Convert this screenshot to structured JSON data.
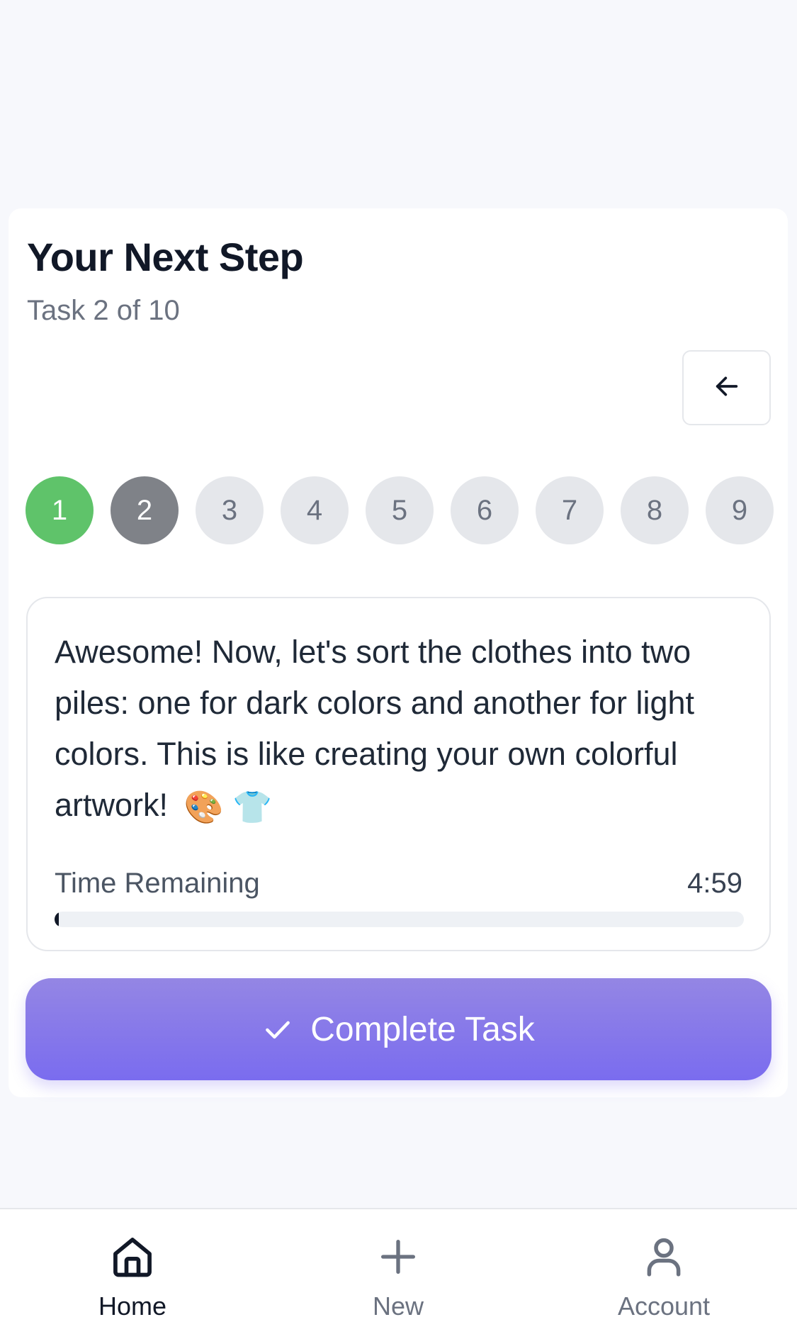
{
  "card": {
    "title": "Your Next Step",
    "subtitle": "Task 2 of 10"
  },
  "back_button": {
    "icon": "arrow-left-icon"
  },
  "steps": [
    {
      "label": "1",
      "state": "done"
    },
    {
      "label": "2",
      "state": "current"
    },
    {
      "label": "3",
      "state": "pending"
    },
    {
      "label": "4",
      "state": "pending"
    },
    {
      "label": "5",
      "state": "pending"
    },
    {
      "label": "6",
      "state": "pending"
    },
    {
      "label": "7",
      "state": "pending"
    },
    {
      "label": "8",
      "state": "pending"
    },
    {
      "label": "9",
      "state": "pending"
    }
  ],
  "task": {
    "text": "Awesome! Now, let's sort the clothes into two piles: one for dark colors and another for light colors. This is like creating your own colorful artwork!",
    "emojis": "🎨 👕",
    "timer_label": "Time Remaining",
    "timer_value": "4:59",
    "progress_fraction": 0.003
  },
  "complete_button": {
    "label": "Complete Task",
    "icon": "check-icon"
  },
  "bottom_nav": [
    {
      "label": "Home",
      "icon": "home-icon",
      "active": true
    },
    {
      "label": "New",
      "icon": "plus-icon",
      "active": false
    },
    {
      "label": "Account",
      "icon": "user-icon",
      "active": false
    }
  ],
  "colors": {
    "step_done": "#5fc36a",
    "step_current": "#7f8288",
    "step_pending": "#e5e7eb",
    "button_gradient_top": "#9486e4",
    "button_gradient_bottom": "#7a6cef"
  }
}
